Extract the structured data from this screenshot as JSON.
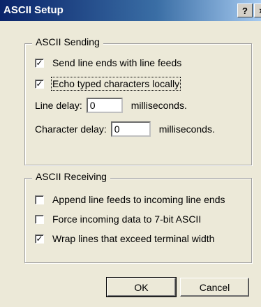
{
  "window": {
    "title": "ASCII Setup",
    "help_label": "?",
    "close_label": "×"
  },
  "sending": {
    "label": "ASCII Sending",
    "send_line_ends": {
      "label": "Send line ends with line feeds",
      "checked": true
    },
    "echo_typed": {
      "label": "Echo typed characters locally",
      "checked": true
    },
    "line_delay": {
      "label": "Line delay:",
      "value": "0",
      "unit": "milliseconds."
    },
    "char_delay": {
      "label": "Character delay:",
      "value": "0",
      "unit": "milliseconds."
    }
  },
  "receiving": {
    "label": "ASCII Receiving",
    "append_line_feeds": {
      "label": "Append line feeds to incoming line ends",
      "checked": false
    },
    "force_7bit": {
      "label": "Force incoming data to 7-bit ASCII",
      "checked": false
    },
    "wrap_lines": {
      "label": "Wrap lines that exceed terminal width",
      "checked": true
    }
  },
  "buttons": {
    "ok": "OK",
    "cancel": "Cancel"
  },
  "colors": {
    "titlebar_start": "#0a246a",
    "titlebar_end": "#a6caf0",
    "dialog_bg": "#ece9d8"
  }
}
